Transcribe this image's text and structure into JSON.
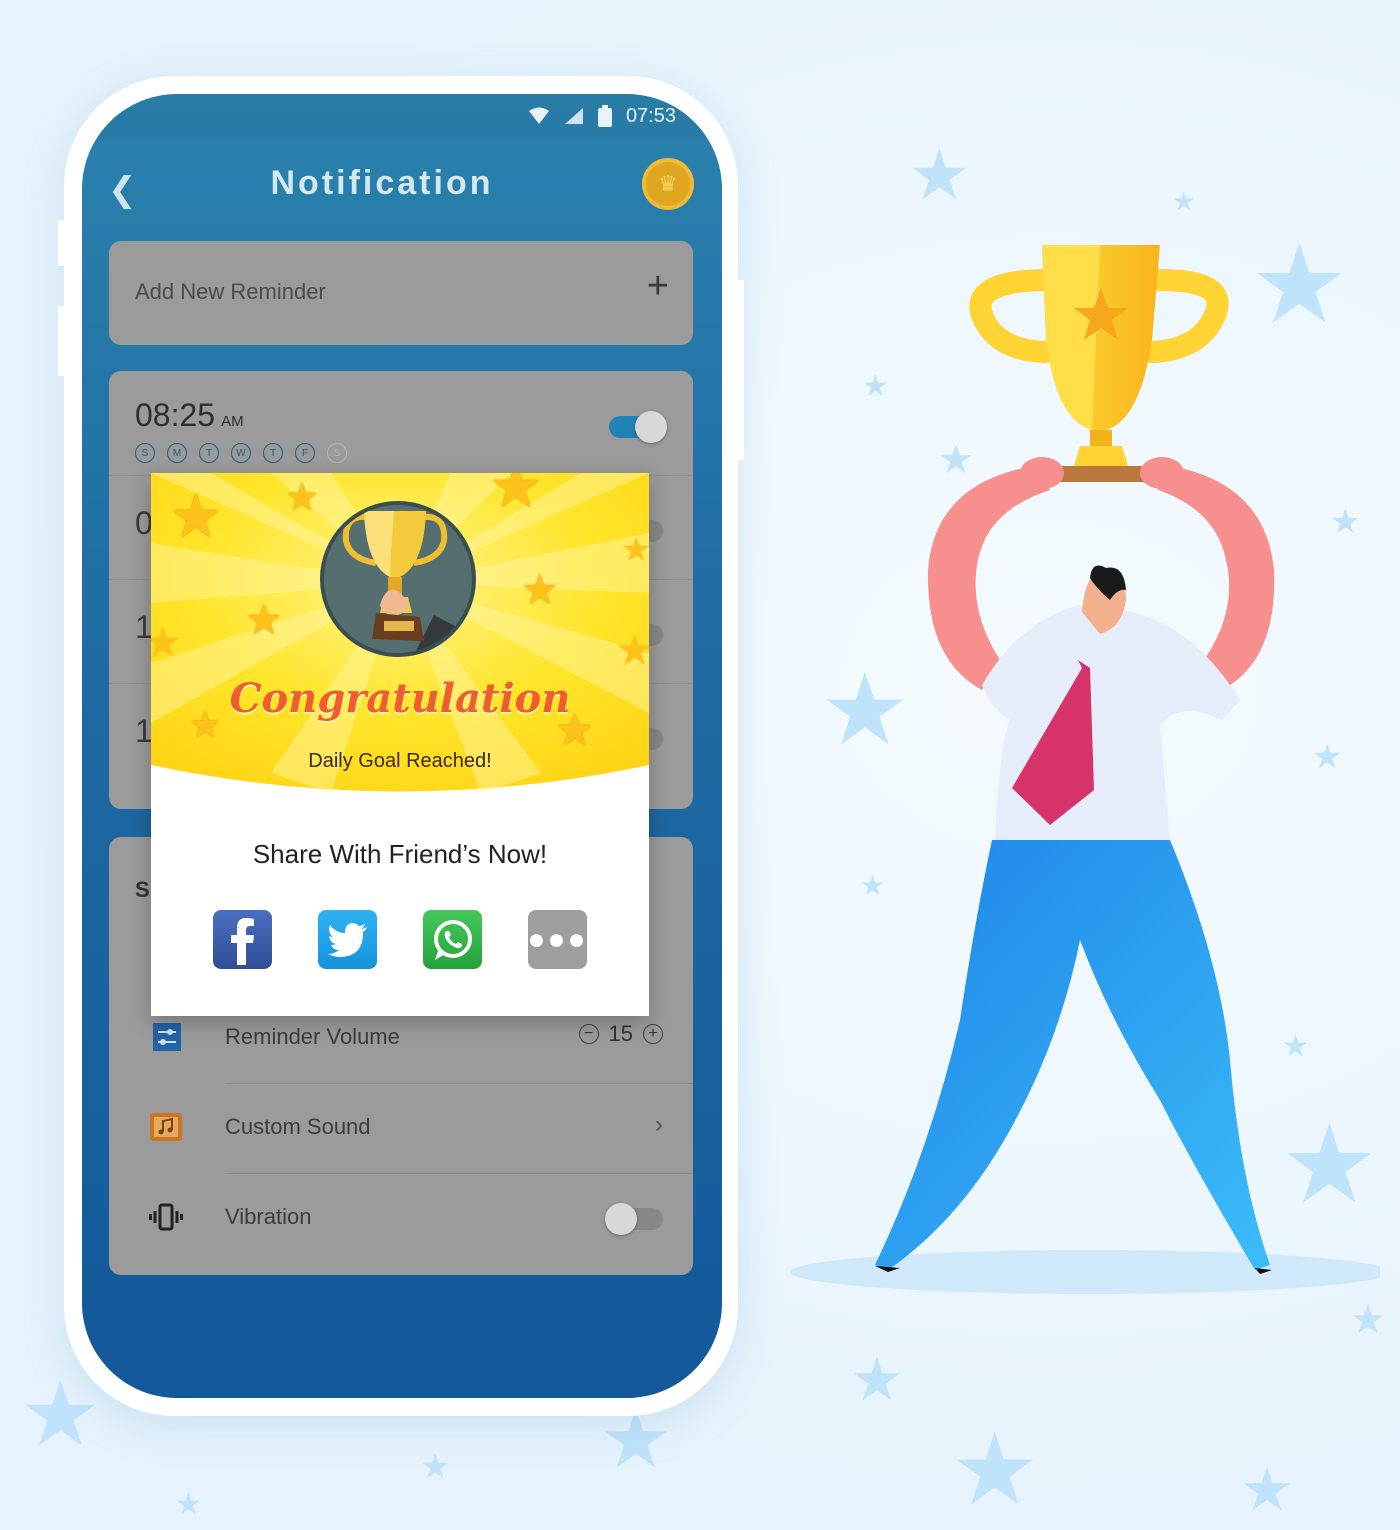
{
  "status_bar": {
    "time": "07:53"
  },
  "app_bar": {
    "title": "Notification"
  },
  "add_reminder": {
    "label": "Add New Reminder"
  },
  "reminders": [
    {
      "time": "08:25",
      "ampm": "AM",
      "enabled": true,
      "days": [
        "S",
        "M",
        "T",
        "W",
        "T",
        "F",
        "S"
      ]
    },
    {
      "time": "0",
      "enabled": false
    },
    {
      "time": "1",
      "enabled": false
    },
    {
      "time": "1",
      "enabled": false
    }
  ],
  "settings": {
    "section_title_partial": "S",
    "reminder_volume": {
      "label": "Reminder Volume",
      "value": "15"
    },
    "custom_sound": {
      "label": "Custom Sound"
    },
    "vibration": {
      "label": "Vibration",
      "enabled": false
    }
  },
  "dialog": {
    "title": "Congratulation",
    "subtitle": "Daily Goal Reached!",
    "share_title": "Share With Friend’s Now!",
    "share_options": [
      "facebook",
      "twitter",
      "whatsapp",
      "more"
    ]
  },
  "colors": {
    "accent_blue": "#2083b5",
    "dialog_yellow": "#ffde22",
    "congrats_orange": "#f05b2f",
    "facebook": "#3a5ca8",
    "twitter": "#1da1f2",
    "whatsapp": "#2fb548",
    "more": "#9e9e9e"
  }
}
